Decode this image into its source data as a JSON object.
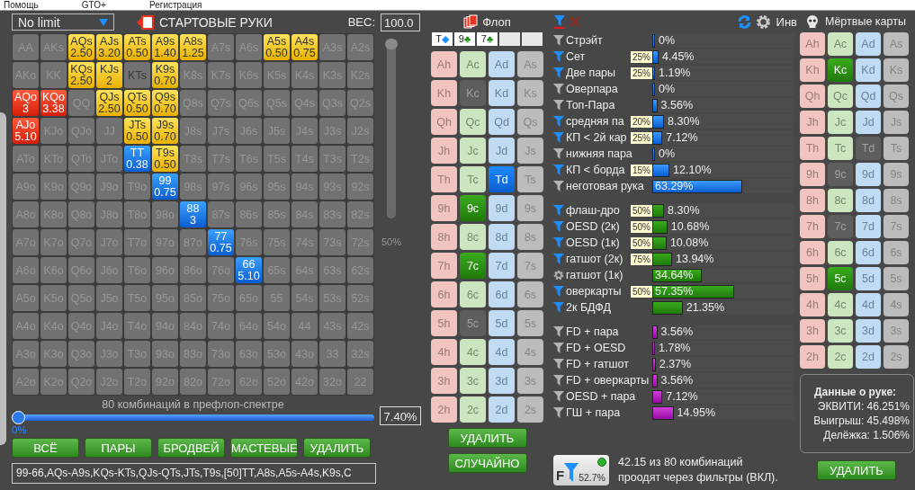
{
  "menu": [
    {
      "label": "Помощь"
    },
    {
      "label": "GTO+"
    },
    {
      "label": "Регистрация"
    }
  ],
  "range_editor": {
    "game_select": "No limit",
    "title": "СТАРТОВЫЕ РУКИ",
    "weight_label": "ВЕС:",
    "weight_value": "100.0",
    "grid": [
      [
        {
          "label": "AA",
          "kind": "off"
        },
        {
          "label": "AKs",
          "kind": "off"
        },
        {
          "label": "AQs",
          "kind": "suited",
          "weight": "2.50"
        },
        {
          "label": "AJs",
          "kind": "suited",
          "weight": "3.20"
        },
        {
          "label": "ATs",
          "kind": "suited",
          "weight": "0.50"
        },
        {
          "label": "A9s",
          "kind": "suited",
          "weight": "1.40"
        },
        {
          "label": "A8s",
          "kind": "suited",
          "weight": "1.25"
        },
        {
          "label": "A7s",
          "kind": "off"
        },
        {
          "label": "A6s",
          "kind": "off"
        },
        {
          "label": "A5s",
          "kind": "suited",
          "weight": "0.50"
        },
        {
          "label": "A4s",
          "kind": "suited",
          "weight": "0.75"
        },
        {
          "label": "A3s",
          "kind": "off"
        },
        {
          "label": "A2s",
          "kind": "off"
        }
      ],
      [
        {
          "label": "AKo",
          "kind": "off"
        },
        {
          "label": "KK",
          "kind": "off"
        },
        {
          "label": "KQs",
          "kind": "suited",
          "weight": "2.50"
        },
        {
          "label": "KJs",
          "kind": "suited",
          "weight": "2"
        },
        {
          "label": "KTs",
          "kind": "blocked"
        },
        {
          "label": "K9s",
          "kind": "suited",
          "weight": "0.70"
        },
        {
          "label": "K8s",
          "kind": "off"
        },
        {
          "label": "K7s",
          "kind": "off"
        },
        {
          "label": "K6s",
          "kind": "off"
        },
        {
          "label": "K5s",
          "kind": "off"
        },
        {
          "label": "K4s",
          "kind": "off"
        },
        {
          "label": "K3s",
          "kind": "off"
        },
        {
          "label": "K2s",
          "kind": "off"
        }
      ],
      [
        {
          "label": "AQo",
          "kind": "offsuit",
          "weight": "3"
        },
        {
          "label": "KQo",
          "kind": "offsuit",
          "weight": "3.38"
        },
        {
          "label": "QQ",
          "kind": "off"
        },
        {
          "label": "QJs",
          "kind": "suited",
          "weight": "2.50"
        },
        {
          "label": "QTs",
          "kind": "suited",
          "weight": "0.50"
        },
        {
          "label": "Q9s",
          "kind": "suited",
          "weight": "0.70"
        },
        {
          "label": "Q8s",
          "kind": "off"
        },
        {
          "label": "Q7s",
          "kind": "off"
        },
        {
          "label": "Q6s",
          "kind": "off"
        },
        {
          "label": "Q5s",
          "kind": "off"
        },
        {
          "label": "Q4s",
          "kind": "off"
        },
        {
          "label": "Q3s",
          "kind": "off"
        },
        {
          "label": "Q2s",
          "kind": "off"
        }
      ],
      [
        {
          "label": "AJo",
          "kind": "offsuit",
          "weight": "5.10"
        },
        {
          "label": "KJo",
          "kind": "off"
        },
        {
          "label": "QJo",
          "kind": "off"
        },
        {
          "label": "JJ",
          "kind": "off"
        },
        {
          "label": "JTs",
          "kind": "suited",
          "weight": "0.50"
        },
        {
          "label": "J9s",
          "kind": "suited",
          "weight": "0.70"
        },
        {
          "label": "J8s",
          "kind": "off"
        },
        {
          "label": "J7s",
          "kind": "off"
        },
        {
          "label": "J6s",
          "kind": "off"
        },
        {
          "label": "J5s",
          "kind": "off"
        },
        {
          "label": "J4s",
          "kind": "off"
        },
        {
          "label": "J3s",
          "kind": "off"
        },
        {
          "label": "J2s",
          "kind": "off"
        }
      ],
      [
        {
          "label": "ATo",
          "kind": "off"
        },
        {
          "label": "KTo",
          "kind": "off"
        },
        {
          "label": "QTo",
          "kind": "off"
        },
        {
          "label": "JTo",
          "kind": "off"
        },
        {
          "label": "TT",
          "kind": "pair",
          "weight": "0.38"
        },
        {
          "label": "T9s",
          "kind": "suited",
          "weight": "0.50"
        },
        {
          "label": "T8s",
          "kind": "off"
        },
        {
          "label": "T7s",
          "kind": "off"
        },
        {
          "label": "T6s",
          "kind": "off"
        },
        {
          "label": "T5s",
          "kind": "off"
        },
        {
          "label": "T4s",
          "kind": "off"
        },
        {
          "label": "T3s",
          "kind": "off"
        },
        {
          "label": "T2s",
          "kind": "off"
        }
      ],
      [
        {
          "label": "A9o",
          "kind": "off"
        },
        {
          "label": "K9o",
          "kind": "off"
        },
        {
          "label": "Q9o",
          "kind": "off"
        },
        {
          "label": "J9o",
          "kind": "off"
        },
        {
          "label": "T9o",
          "kind": "off"
        },
        {
          "label": "99",
          "kind": "pair",
          "weight": "0.75"
        },
        {
          "label": "98s",
          "kind": "off"
        },
        {
          "label": "97s",
          "kind": "off"
        },
        {
          "label": "96s",
          "kind": "off"
        },
        {
          "label": "95s",
          "kind": "off"
        },
        {
          "label": "94s",
          "kind": "off"
        },
        {
          "label": "93s",
          "kind": "off"
        },
        {
          "label": "92s",
          "kind": "off"
        }
      ],
      [
        {
          "label": "A8o",
          "kind": "off"
        },
        {
          "label": "K8o",
          "kind": "off"
        },
        {
          "label": "Q8o",
          "kind": "off"
        },
        {
          "label": "J8o",
          "kind": "off"
        },
        {
          "label": "T8o",
          "kind": "off"
        },
        {
          "label": "98o",
          "kind": "off"
        },
        {
          "label": "88",
          "kind": "pair",
          "weight": "3"
        },
        {
          "label": "87s",
          "kind": "off"
        },
        {
          "label": "86s",
          "kind": "off"
        },
        {
          "label": "85s",
          "kind": "off"
        },
        {
          "label": "84s",
          "kind": "off"
        },
        {
          "label": "83s",
          "kind": "off"
        },
        {
          "label": "82s",
          "kind": "off"
        }
      ],
      [
        {
          "label": "A7o",
          "kind": "off"
        },
        {
          "label": "K7o",
          "kind": "off"
        },
        {
          "label": "Q7o",
          "kind": "off"
        },
        {
          "label": "J7o",
          "kind": "off"
        },
        {
          "label": "T7o",
          "kind": "off"
        },
        {
          "label": "97o",
          "kind": "off"
        },
        {
          "label": "87o",
          "kind": "off"
        },
        {
          "label": "77",
          "kind": "pair",
          "weight": "0.75"
        },
        {
          "label": "76s",
          "kind": "off"
        },
        {
          "label": "75s",
          "kind": "off"
        },
        {
          "label": "74s",
          "kind": "off"
        },
        {
          "label": "73s",
          "kind": "off"
        },
        {
          "label": "72s",
          "kind": "off"
        }
      ],
      [
        {
          "label": "A6o",
          "kind": "off"
        },
        {
          "label": "K6o",
          "kind": "off"
        },
        {
          "label": "Q6o",
          "kind": "off"
        },
        {
          "label": "J6o",
          "kind": "off"
        },
        {
          "label": "T6o",
          "kind": "off"
        },
        {
          "label": "96o",
          "kind": "off"
        },
        {
          "label": "86o",
          "kind": "off"
        },
        {
          "label": "76o",
          "kind": "off"
        },
        {
          "label": "66",
          "kind": "pair",
          "weight": "5.10"
        },
        {
          "label": "65s",
          "kind": "off"
        },
        {
          "label": "64s",
          "kind": "off"
        },
        {
          "label": "63s",
          "kind": "off"
        },
        {
          "label": "62s",
          "kind": "off"
        }
      ],
      [
        {
          "label": "A5o",
          "kind": "off"
        },
        {
          "label": "K5o",
          "kind": "off"
        },
        {
          "label": "Q5o",
          "kind": "off"
        },
        {
          "label": "J5o",
          "kind": "off"
        },
        {
          "label": "T5o",
          "kind": "off"
        },
        {
          "label": "95o",
          "kind": "off"
        },
        {
          "label": "85o",
          "kind": "off"
        },
        {
          "label": "75o",
          "kind": "off"
        },
        {
          "label": "65o",
          "kind": "off"
        },
        {
          "label": "55",
          "kind": "off"
        },
        {
          "label": "54s",
          "kind": "off"
        },
        {
          "label": "53s",
          "kind": "off"
        },
        {
          "label": "52s",
          "kind": "off"
        }
      ],
      [
        {
          "label": "A4o",
          "kind": "off"
        },
        {
          "label": "K4o",
          "kind": "off"
        },
        {
          "label": "Q4o",
          "kind": "off"
        },
        {
          "label": "J4o",
          "kind": "off"
        },
        {
          "label": "T4o",
          "kind": "off"
        },
        {
          "label": "94o",
          "kind": "off"
        },
        {
          "label": "84o",
          "kind": "off"
        },
        {
          "label": "74o",
          "kind": "off"
        },
        {
          "label": "64o",
          "kind": "off"
        },
        {
          "label": "54o",
          "kind": "off"
        },
        {
          "label": "44",
          "kind": "off"
        },
        {
          "label": "43s",
          "kind": "off"
        },
        {
          "label": "42s",
          "kind": "off"
        }
      ],
      [
        {
          "label": "A3o",
          "kind": "off"
        },
        {
          "label": "K3o",
          "kind": "off"
        },
        {
          "label": "Q3o",
          "kind": "off"
        },
        {
          "label": "J3o",
          "kind": "off"
        },
        {
          "label": "T3o",
          "kind": "off"
        },
        {
          "label": "93o",
          "kind": "off"
        },
        {
          "label": "83o",
          "kind": "off"
        },
        {
          "label": "73o",
          "kind": "off"
        },
        {
          "label": "63o",
          "kind": "off"
        },
        {
          "label": "53o",
          "kind": "off"
        },
        {
          "label": "43o",
          "kind": "off"
        },
        {
          "label": "33",
          "kind": "off"
        },
        {
          "label": "32s",
          "kind": "off"
        }
      ],
      [
        {
          "label": "A2o",
          "kind": "off"
        },
        {
          "label": "K2o",
          "kind": "off"
        },
        {
          "label": "Q2o",
          "kind": "off"
        },
        {
          "label": "J2o",
          "kind": "off"
        },
        {
          "label": "T2o",
          "kind": "off"
        },
        {
          "label": "92o",
          "kind": "off"
        },
        {
          "label": "82o",
          "kind": "off"
        },
        {
          "label": "72o",
          "kind": "off"
        },
        {
          "label": "62o",
          "kind": "off"
        },
        {
          "label": "52o",
          "kind": "off"
        },
        {
          "label": "42o",
          "kind": "off"
        },
        {
          "label": "32o",
          "kind": "off"
        },
        {
          "label": "22",
          "kind": "off"
        }
      ]
    ],
    "weight_slider": {
      "level": 1,
      "scale_label": "50%"
    },
    "caption": "80 комбинаций в префлоп-спектре",
    "range_slider": {
      "level": 0,
      "reading": "0%",
      "value": "7.40%"
    },
    "buttons": [
      {
        "label": "ВСЁ"
      },
      {
        "label": "ПАРЫ"
      },
      {
        "label": "БРОДВЕЙ"
      },
      {
        "label": "МАСТЕВЫЕ"
      },
      {
        "label": "УДАЛИТЬ"
      }
    ],
    "range_text": "99-66,AQs-A9s,KQs-KTs,QJs-QTs,JTs,T9s,[50]TT,A8s,A5s-A4s,K9s,C"
  },
  "flop": {
    "title": "Флоп",
    "board": [
      {
        "filled": true,
        "rank": "T",
        "suit": "◆",
        "color": "#1e90ff"
      },
      {
        "filled": true,
        "rank": "9",
        "suit": "♣",
        "color": "#1a8a10"
      },
      {
        "filled": true,
        "rank": "7",
        "suit": "♣",
        "color": "#1a8a10"
      },
      {
        "filled": false
      },
      {
        "filled": false
      }
    ],
    "deck": [
      [
        {
          "label": "Ah",
          "selected": false,
          "disabled": false
        },
        {
          "label": "Ac",
          "selected": false,
          "disabled": false
        },
        {
          "label": "Ad",
          "selected": false,
          "disabled": false
        },
        {
          "label": "As",
          "selected": false,
          "disabled": false
        }
      ],
      [
        {
          "label": "Kh",
          "selected": false,
          "disabled": false
        },
        {
          "label": "Kc",
          "selected": false,
          "disabled": true
        },
        {
          "label": "Kd",
          "selected": false,
          "disabled": false
        },
        {
          "label": "Ks",
          "selected": false,
          "disabled": false
        }
      ],
      [
        {
          "label": "Qh",
          "selected": false,
          "disabled": false
        },
        {
          "label": "Qc",
          "selected": false,
          "disabled": false
        },
        {
          "label": "Qd",
          "selected": false,
          "disabled": false
        },
        {
          "label": "Qs",
          "selected": false,
          "disabled": false
        }
      ],
      [
        {
          "label": "Jh",
          "selected": false,
          "disabled": false
        },
        {
          "label": "Jc",
          "selected": false,
          "disabled": false
        },
        {
          "label": "Jd",
          "selected": false,
          "disabled": false
        },
        {
          "label": "Js",
          "selected": false,
          "disabled": false
        }
      ],
      [
        {
          "label": "Th",
          "selected": false,
          "disabled": false
        },
        {
          "label": "Tc",
          "selected": false,
          "disabled": false
        },
        {
          "label": "Td",
          "selected": true,
          "disabled": false
        },
        {
          "label": "Ts",
          "selected": false,
          "disabled": false
        }
      ],
      [
        {
          "label": "9h",
          "selected": false,
          "disabled": false
        },
        {
          "label": "9c",
          "selected": true,
          "disabled": false
        },
        {
          "label": "9d",
          "selected": false,
          "disabled": false
        },
        {
          "label": "9s",
          "selected": false,
          "disabled": false
        }
      ],
      [
        {
          "label": "8h",
          "selected": false,
          "disabled": false
        },
        {
          "label": "8c",
          "selected": false,
          "disabled": false
        },
        {
          "label": "8d",
          "selected": false,
          "disabled": false
        },
        {
          "label": "8s",
          "selected": false,
          "disabled": false
        }
      ],
      [
        {
          "label": "7h",
          "selected": false,
          "disabled": false
        },
        {
          "label": "7c",
          "selected": true,
          "disabled": false
        },
        {
          "label": "7d",
          "selected": false,
          "disabled": false
        },
        {
          "label": "7s",
          "selected": false,
          "disabled": false
        }
      ],
      [
        {
          "label": "6h",
          "selected": false,
          "disabled": false
        },
        {
          "label": "6c",
          "selected": false,
          "disabled": false
        },
        {
          "label": "6d",
          "selected": false,
          "disabled": false
        },
        {
          "label": "6s",
          "selected": false,
          "disabled": false
        }
      ],
      [
        {
          "label": "5h",
          "selected": false,
          "disabled": false
        },
        {
          "label": "5c",
          "selected": false,
          "disabled": true
        },
        {
          "label": "5d",
          "selected": false,
          "disabled": false
        },
        {
          "label": "5s",
          "selected": false,
          "disabled": false
        }
      ],
      [
        {
          "label": "4h",
          "selected": false,
          "disabled": false
        },
        {
          "label": "4c",
          "selected": false,
          "disabled": false
        },
        {
          "label": "4d",
          "selected": false,
          "disabled": false
        },
        {
          "label": "4s",
          "selected": false,
          "disabled": false
        }
      ],
      [
        {
          "label": "3h",
          "selected": false,
          "disabled": false
        },
        {
          "label": "3c",
          "selected": false,
          "disabled": false
        },
        {
          "label": "3d",
          "selected": false,
          "disabled": false
        },
        {
          "label": "3s",
          "selected": false,
          "disabled": false
        }
      ],
      [
        {
          "label": "2h",
          "selected": false,
          "disabled": false
        },
        {
          "label": "2c",
          "selected": false,
          "disabled": false
        },
        {
          "label": "2d",
          "selected": false,
          "disabled": false
        },
        {
          "label": "2s",
          "selected": false,
          "disabled": false
        }
      ]
    ],
    "buttons": [
      {
        "label": "УДАЛИТЬ"
      },
      {
        "label": "СЛУЧАЙНО"
      }
    ]
  },
  "filters": {
    "invert_label": "Инв",
    "groups": [
      {
        "kind": "made",
        "rows": [
          {
            "label": "Стрэйт",
            "kind": "filter",
            "active": false,
            "level": 0,
            "value": "0%"
          },
          {
            "label": "Сет",
            "kind": "filter",
            "active": true,
            "badge": "25%",
            "level": 0.0445,
            "value": "4.45%"
          },
          {
            "label": "Две пары",
            "kind": "filter",
            "active": true,
            "badge": "25%",
            "level": 0.0119,
            "value": "1.19%"
          },
          {
            "label": "Оверпара",
            "kind": "filter",
            "active": false,
            "level": 0,
            "value": "0%"
          },
          {
            "label": "Топ-Пара",
            "kind": "filter",
            "active": false,
            "level": 0.0356,
            "value": "3.56%"
          },
          {
            "label": "средняя па",
            "kind": "filter",
            "active": true,
            "badge": "20%",
            "level": 0.083,
            "value": "8.30%"
          },
          {
            "label": "КП < 2й кар",
            "kind": "filter",
            "active": true,
            "badge": "25%",
            "level": 0.0712,
            "value": "7.12%"
          },
          {
            "label": "нижняя пара",
            "kind": "filter",
            "active": false,
            "level": 0,
            "value": "0%"
          },
          {
            "label": "КП < борда",
            "kind": "filter",
            "active": true,
            "badge": "15%",
            "level": 0.121,
            "value": "12.10%"
          },
          {
            "label": "неготовая рука",
            "kind": "filter",
            "active": false,
            "level": 0.6329,
            "value": "63.29%"
          }
        ]
      },
      {
        "kind": "draw",
        "rows": [
          {
            "label": "флаш-дро",
            "kind": "filter",
            "active": true,
            "badge": "50%",
            "level": 0.083,
            "value": "8.30%"
          },
          {
            "label": "OESD (2к)",
            "kind": "filter",
            "active": true,
            "badge": "50%",
            "level": 0.1068,
            "value": "10.68%"
          },
          {
            "label": "OESD (1к)",
            "kind": "filter",
            "active": true,
            "badge": "50%",
            "level": 0.1008,
            "value": "10.08%"
          },
          {
            "label": "гатшот (2к)",
            "kind": "filter",
            "active": true,
            "badge": "75%",
            "level": 0.1394,
            "value": "13.94%"
          },
          {
            "label": "гатшот (1к)",
            "kind": "settings",
            "active": false,
            "level": 0.3464,
            "value": "34.64%"
          },
          {
            "label": "оверкарты",
            "kind": "filter",
            "active": true,
            "badge": "50%",
            "level": 0.5735,
            "value": "57.35%"
          },
          {
            "label": "2к БДФД",
            "kind": "filter",
            "active": true,
            "level": 0.2135,
            "value": "21.35%"
          }
        ]
      },
      {
        "kind": "combo",
        "rows": [
          {
            "label": "FD + пара",
            "kind": "filter",
            "active": false,
            "level": 0.0356,
            "value": "3.56%"
          },
          {
            "label": "FD + OESD",
            "kind": "filter",
            "active": false,
            "level": 0.0178,
            "value": "1.78%"
          },
          {
            "label": "FD + гатшот",
            "kind": "filter",
            "active": false,
            "level": 0.0237,
            "value": "2.37%"
          },
          {
            "label": "FD + оверкарты",
            "kind": "filter",
            "active": false,
            "level": 0.0356,
            "value": "3.56%"
          },
          {
            "label": "OESD + пара",
            "kind": "filter",
            "active": false,
            "level": 0.0712,
            "value": "7.12%"
          },
          {
            "label": "ГШ + пара",
            "kind": "filter",
            "active": false,
            "level": 0.1495,
            "value": "14.95%"
          }
        ]
      }
    ],
    "summary_button": {
      "letter": "F",
      "percent": "52.7%"
    },
    "summary_lines": [
      "42.15 из 80 комбинаций",
      "проодят через фильтры (ВКЛ)."
    ]
  },
  "dead_cards": {
    "title": "Мёртвые карты",
    "deck": [
      [
        {
          "label": "Ah",
          "selected": false,
          "disabled": false
        },
        {
          "label": "Ac",
          "selected": false,
          "disabled": false
        },
        {
          "label": "Ad",
          "selected": false,
          "disabled": false
        },
        {
          "label": "As",
          "selected": false,
          "disabled": false
        }
      ],
      [
        {
          "label": "Kh",
          "selected": false,
          "disabled": false
        },
        {
          "label": "Kc",
          "selected": true,
          "disabled": false
        },
        {
          "label": "Kd",
          "selected": false,
          "disabled": false
        },
        {
          "label": "Ks",
          "selected": false,
          "disabled": false
        }
      ],
      [
        {
          "label": "Qh",
          "selected": false,
          "disabled": false
        },
        {
          "label": "Qc",
          "selected": false,
          "disabled": false
        },
        {
          "label": "Qd",
          "selected": false,
          "disabled": false
        },
        {
          "label": "Qs",
          "selected": false,
          "disabled": false
        }
      ],
      [
        {
          "label": "Jh",
          "selected": false,
          "disabled": false
        },
        {
          "label": "Jc",
          "selected": false,
          "disabled": false
        },
        {
          "label": "Jd",
          "selected": false,
          "disabled": false
        },
        {
          "label": "Js",
          "selected": false,
          "disabled": false
        }
      ],
      [
        {
          "label": "Th",
          "selected": false,
          "disabled": false
        },
        {
          "label": "Tc",
          "selected": false,
          "disabled": false
        },
        {
          "label": "Td",
          "selected": false,
          "disabled": true
        },
        {
          "label": "Ts",
          "selected": false,
          "disabled": false
        }
      ],
      [
        {
          "label": "9h",
          "selected": false,
          "disabled": false
        },
        {
          "label": "9c",
          "selected": false,
          "disabled": true
        },
        {
          "label": "9d",
          "selected": false,
          "disabled": false
        },
        {
          "label": "9s",
          "selected": false,
          "disabled": false
        }
      ],
      [
        {
          "label": "8h",
          "selected": false,
          "disabled": false
        },
        {
          "label": "8c",
          "selected": false,
          "disabled": false
        },
        {
          "label": "8d",
          "selected": false,
          "disabled": false
        },
        {
          "label": "8s",
          "selected": false,
          "disabled": false
        }
      ],
      [
        {
          "label": "7h",
          "selected": false,
          "disabled": false
        },
        {
          "label": "7c",
          "selected": false,
          "disabled": true
        },
        {
          "label": "7d",
          "selected": false,
          "disabled": false
        },
        {
          "label": "7s",
          "selected": false,
          "disabled": false
        }
      ],
      [
        {
          "label": "6h",
          "selected": false,
          "disabled": false
        },
        {
          "label": "6c",
          "selected": false,
          "disabled": false
        },
        {
          "label": "6d",
          "selected": false,
          "disabled": false
        },
        {
          "label": "6s",
          "selected": false,
          "disabled": false
        }
      ],
      [
        {
          "label": "5h",
          "selected": false,
          "disabled": false
        },
        {
          "label": "5c",
          "selected": true,
          "disabled": false
        },
        {
          "label": "5d",
          "selected": false,
          "disabled": false
        },
        {
          "label": "5s",
          "selected": false,
          "disabled": false
        }
      ],
      [
        {
          "label": "4h",
          "selected": false,
          "disabled": false
        },
        {
          "label": "4c",
          "selected": false,
          "disabled": false
        },
        {
          "label": "4d",
          "selected": false,
          "disabled": false
        },
        {
          "label": "4s",
          "selected": false,
          "disabled": false
        }
      ],
      [
        {
          "label": "3h",
          "selected": false,
          "disabled": false
        },
        {
          "label": "3c",
          "selected": false,
          "disabled": false
        },
        {
          "label": "3d",
          "selected": false,
          "disabled": false
        },
        {
          "label": "3s",
          "selected": false,
          "disabled": false
        }
      ],
      [
        {
          "label": "2h",
          "selected": false,
          "disabled": false
        },
        {
          "label": "2c",
          "selected": false,
          "disabled": false
        },
        {
          "label": "2d",
          "selected": false,
          "disabled": false
        },
        {
          "label": "2s",
          "selected": false,
          "disabled": false
        }
      ]
    ],
    "hand_data": {
      "title": "Данные о руке:",
      "lines": [
        "ЭКВИТИ: 46.251%",
        "Выигрыш: 45.498%",
        "Делёжка: 1.506%"
      ]
    },
    "button": {
      "label": "УДАЛИТЬ"
    }
  }
}
